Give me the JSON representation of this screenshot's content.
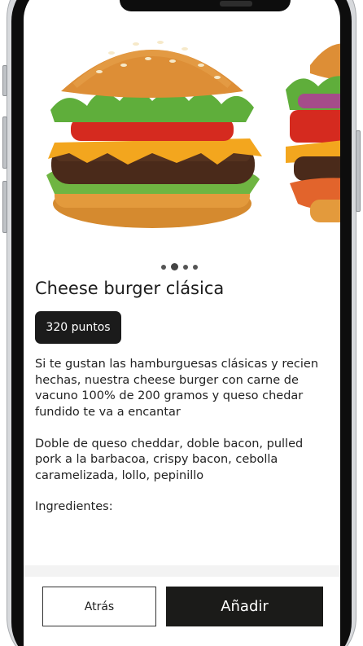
{
  "product": {
    "title": "Cheese burger clásica",
    "points_badge": "320 puntos",
    "description": [
      "Si te gustan las hamburguesas clásicas y recien hechas, nuestra cheese burger con carne de vacuno 100% de 200 gramos y queso chedar fundido te va a encantar",
      "Doble de queso cheddar, doble bacon, pulled pork a la barbacoa, crispy bacon, cebolla caramelizada, lollo, pepinillo"
    ],
    "ingredients_label": "Ingredientes:"
  },
  "carousel": {
    "slide_count": 4,
    "active_index": 1,
    "images": [
      "cheeseburger-photo",
      "burger-photo"
    ]
  },
  "actions": {
    "back_label": "Atrás",
    "add_label": "Añadir"
  },
  "colors": {
    "primary_dark": "#1b1b1b",
    "background": "#ffffff"
  }
}
